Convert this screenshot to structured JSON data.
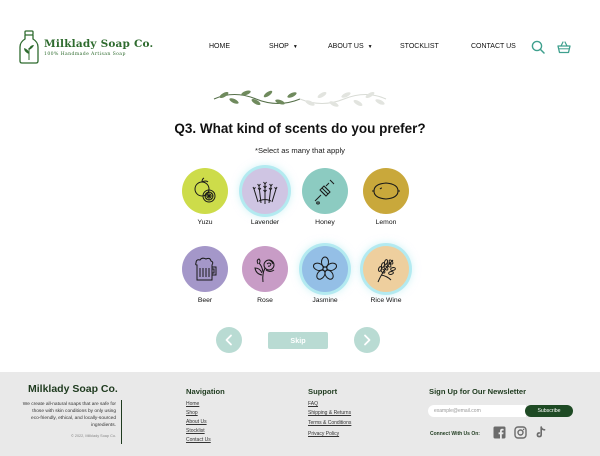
{
  "header": {
    "brand": "Milklady Soap Co.",
    "tagline": "100% Handmade Artisan Soap",
    "nav": {
      "home": "HOME",
      "shop": "SHOP",
      "about": "ABOUT US",
      "stocklist": "STOCKLIST",
      "contact": "CONTACT US"
    },
    "icons": [
      "search-icon",
      "basket-icon",
      "chevron-down-icon"
    ]
  },
  "quiz": {
    "question": "Q3. What kind of scents do you prefer?",
    "instruction": "*Select as many that apply",
    "options": [
      {
        "label": "Yuzu",
        "color": "#cddc4a",
        "icon": "yuzu-icon",
        "selected": false
      },
      {
        "label": "Lavender",
        "color": "#cfc5e3",
        "icon": "lavender-icon",
        "selected": true
      },
      {
        "label": "Honey",
        "color": "#8ccbc1",
        "icon": "honey-dipper-icon",
        "selected": false
      },
      {
        "label": "Lemon",
        "color": "#c9a83b",
        "icon": "lemon-icon",
        "selected": false
      },
      {
        "label": "Beer",
        "color": "#a497c9",
        "icon": "beer-mug-icon",
        "selected": false
      },
      {
        "label": "Rose",
        "color": "#c89cc6",
        "icon": "rose-icon",
        "selected": false
      },
      {
        "label": "Jasmine",
        "color": "#94bfe6",
        "icon": "jasmine-flower-icon",
        "selected": true
      },
      {
        "label": "Rice Wine",
        "color": "#eecf9e",
        "icon": "rice-stalk-icon",
        "selected": true
      }
    ],
    "skip_label": "Skip",
    "button_color": "#b9dbd3"
  },
  "footer": {
    "brand": "Milklady Soap Co.",
    "description": "We create all-natural soaps that are safe for those with skin conditions by only using eco-friendly, ethical, and locally-sourced ingredients.",
    "copyright": "© 2022, Milklady Soap Co.",
    "navigation": {
      "heading": "Navigation",
      "links": [
        "Home",
        "Shop",
        "About Us",
        "Stocklist",
        "Contact Us"
      ]
    },
    "support": {
      "heading": "Support",
      "links": [
        "FAQ",
        "Shipping & Returns",
        "Terms & Conditions",
        "Privacy Policy"
      ]
    },
    "newsletter": {
      "heading": "Sign Up for Our Newsletter",
      "placeholder": "example@email.com",
      "button": "Subscribe",
      "connect": "Connect With Us On:"
    },
    "colors": {
      "background": "#e9e9e9",
      "brand_green": "#1e4a24"
    }
  }
}
